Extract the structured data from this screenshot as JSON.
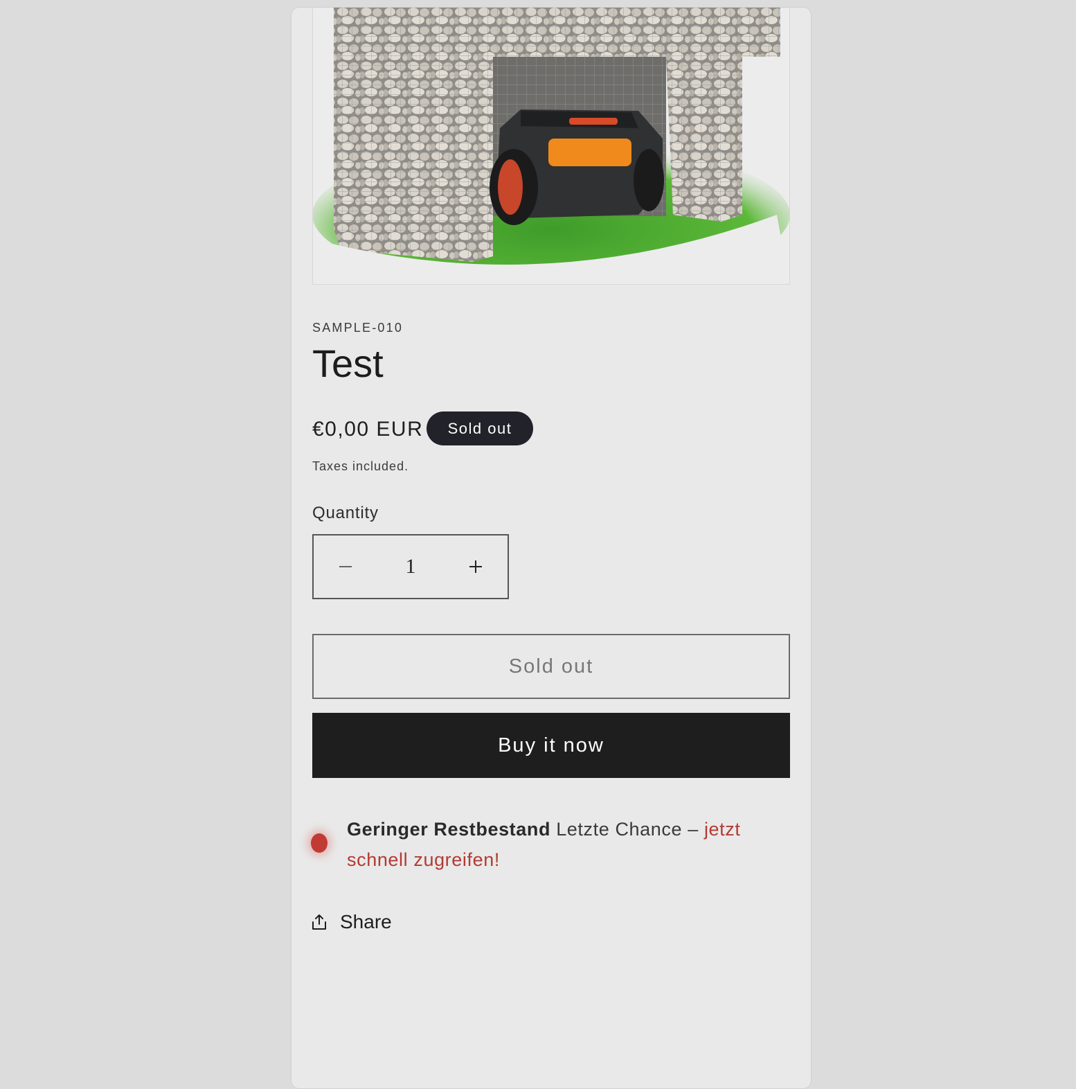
{
  "product": {
    "image_alt": "Gabion robotic mower garage with lawn mower on grass",
    "sku": "SAMPLE-010",
    "title": "Test",
    "price": "€0,00 EUR",
    "badge": "Sold out",
    "taxes_note": "Taxes included."
  },
  "quantity": {
    "label": "Quantity",
    "value": "1",
    "decrease_icon": "minus-icon",
    "increase_icon": "plus-icon"
  },
  "buttons": {
    "sold_out_label": "Sold out",
    "buy_now_label": "Buy it now"
  },
  "stock_notice": {
    "strong": "Geringer Restbestand",
    "text": "Letzte Chance –",
    "urgent": "jetzt schnell zugreifen!",
    "dot_color": "#c23a34"
  },
  "share": {
    "label": "Share",
    "icon": "share-icon"
  }
}
